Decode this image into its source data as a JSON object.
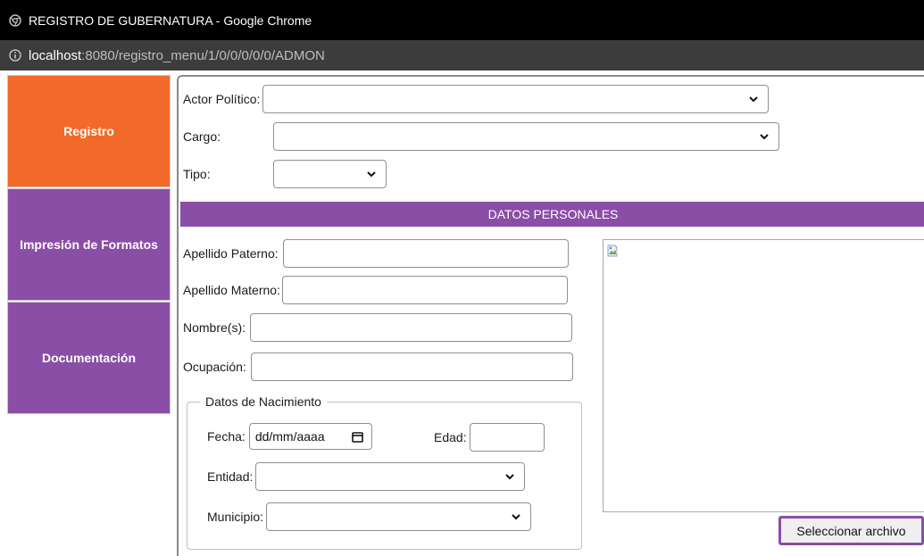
{
  "window": {
    "title": "REGISTRO DE GUBERNATURA - Google Chrome"
  },
  "address_bar": {
    "host": "localhost",
    "path": ":8080/registro_menu/1/0/0/0/0/0/ADMON"
  },
  "sidebar": {
    "items": [
      {
        "label": "Registro",
        "color": "#f26a29"
      },
      {
        "label": "Impresión de Formatos",
        "color": "#8b4ea6"
      },
      {
        "label": "Documentación",
        "color": "#8b4ea6"
      }
    ]
  },
  "form": {
    "actor_politico_label": "Actor Político:",
    "actor_politico_value": "",
    "cargo_label": "Cargo:",
    "cargo_value": "",
    "tipo_label": "Tipo:",
    "tipo_value": "",
    "section_title": "DATOS PERSONALES",
    "apellido_paterno_label": "Apellido Paterno:",
    "apellido_paterno_value": "",
    "apellido_materno_label": "Apellido Materno:",
    "apellido_materno_value": "",
    "nombres_label": "Nombre(s):",
    "nombres_value": "",
    "ocupacion_label": "Ocupación:",
    "ocupacion_value": "",
    "nacimiento": {
      "legend": "Datos de Nacimiento",
      "fecha_label": "Fecha:",
      "fecha_placeholder": "dd/mm/aaaa",
      "edad_label": "Edad:",
      "edad_value": "",
      "entidad_label": "Entidad:",
      "entidad_value": "",
      "municipio_label": "Municipio:",
      "municipio_value": ""
    },
    "file_button_label": "Seleccionar archivo"
  },
  "colors": {
    "accent_orange": "#f26a29",
    "accent_purple": "#8b4ea6"
  }
}
